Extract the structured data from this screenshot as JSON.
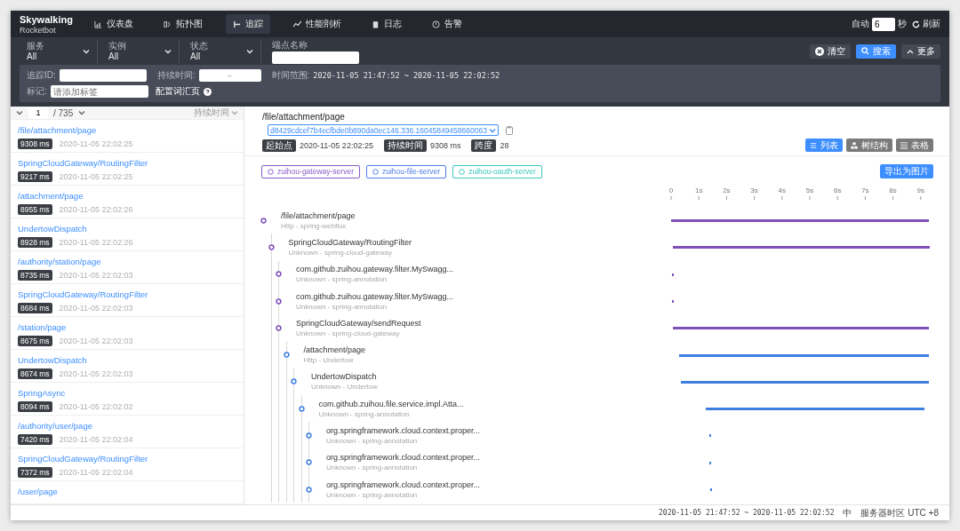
{
  "brand": {
    "name": "Skywalking",
    "sub": "Rocketbot"
  },
  "nav": [
    {
      "label": "仪表盘",
      "kind": "dashboard",
      "selected": false
    },
    {
      "label": "拓扑图",
      "kind": "topology",
      "selected": false
    },
    {
      "label": "追踪",
      "kind": "trace",
      "selected": true
    },
    {
      "label": "性能剖析",
      "kind": "profile",
      "selected": false
    },
    {
      "label": "日志",
      "kind": "log",
      "selected": false
    },
    {
      "label": "告警",
      "kind": "alarm",
      "selected": false
    }
  ],
  "auto_refresh": {
    "label": "自动",
    "value": "6",
    "unit": "秒",
    "button": "刷新"
  },
  "filters": [
    {
      "label": "服务",
      "value": "All",
      "kind": "select"
    },
    {
      "label": "实例",
      "value": "All",
      "kind": "select"
    },
    {
      "label": "状态",
      "value": "All",
      "kind": "select"
    },
    {
      "label": "端点名称",
      "kind": "input"
    }
  ],
  "actions": [
    {
      "label": "清空",
      "kind": "clear"
    },
    {
      "label": "搜索",
      "kind": "search"
    },
    {
      "label": "更多",
      "kind": "more"
    }
  ],
  "more_panel": {
    "trace_id_label": "追踪ID:",
    "duration_label": "持续时间:",
    "duration_separator": "–",
    "time_range_label": "时间范围:",
    "time_range": "2020-11-05 21:47:52 ~ 2020-11-05 22:02:52",
    "tags_label": "标记:",
    "tags_placeholder": "请添加标签",
    "vocab_link": "配置词汇页"
  },
  "list": {
    "page": "1",
    "total": "/ 735",
    "sort": "持续时间",
    "items": [
      {
        "name": "/file/attachment/page",
        "duration": "9308 ms",
        "time": "2020-11-05 22:02:25"
      },
      {
        "name": "SpringCloudGateway/RoutingFilter",
        "duration": "9217 ms",
        "time": "2020-11-05 22:02:25"
      },
      {
        "name": "/attachment/page",
        "duration": "8955 ms",
        "time": "2020-11-05 22:02:26"
      },
      {
        "name": "UndertowDispatch",
        "duration": "8928 ms",
        "time": "2020-11-05 22:02:26"
      },
      {
        "name": "/authority/station/page",
        "duration": "8735 ms",
        "time": "2020-11-05 22:02:03"
      },
      {
        "name": "SpringCloudGateway/RoutingFilter",
        "duration": "8684 ms",
        "time": "2020-11-05 22:02:03"
      },
      {
        "name": "/station/page",
        "duration": "8675 ms",
        "time": "2020-11-05 22:02:03"
      },
      {
        "name": "UndertowDispatch",
        "duration": "8674 ms",
        "time": "2020-11-05 22:02:03"
      },
      {
        "name": "SpringAsync",
        "duration": "8094 ms",
        "time": "2020-11-05 22:02:02"
      },
      {
        "name": "/authority/user/page",
        "duration": "7420 ms",
        "time": "2020-11-05 22:02:04"
      },
      {
        "name": "SpringCloudGateway/RoutingFilter",
        "duration": "7372 ms",
        "time": "2020-11-05 22:02:04"
      },
      {
        "name": "/user/page"
      }
    ]
  },
  "detail": {
    "title": "/file/attachment/page",
    "trace_id": "d8429cdcef7b4ecfbde0b890da0ec146.336.16045849458660063",
    "meta": [
      {
        "label": "起始点",
        "value": "2020-11-05 22:02:25"
      },
      {
        "label": "持续时间",
        "value": "9308 ms"
      },
      {
        "label": "跨度",
        "value": "28"
      }
    ],
    "views": [
      {
        "label": "列表",
        "kind": "list",
        "selected": true
      },
      {
        "label": "树结构",
        "kind": "tree",
        "selected": false
      },
      {
        "label": "表格",
        "kind": "table",
        "selected": false
      }
    ],
    "services": [
      {
        "name": "zuihou-gateway-server",
        "color": "#8a5cc7"
      },
      {
        "name": "zuihou-file-server",
        "color": "#4f7fe8"
      },
      {
        "name": "zuihou-oauth-server",
        "color": "#3cc8c0"
      }
    ],
    "export": "导出为图片",
    "spans": [
      {
        "name": "/file/attachment/page",
        "meta": "Http - spring-webflux",
        "color": "#7e4fb9",
        "children": [
          {
            "name": "SpringCloudGateway/RoutingFilter",
            "meta": "Unknown - spring-cloud-gateway",
            "color": "#7e4fb9",
            "children": [
              {
                "name": "com.github.zuihou.gateway.filter.MySwagg...",
                "meta": "Unknown - spring-annotation",
                "color": "#7e4fb9"
              },
              {
                "name": "com.github.zuihou.gateway.filter.MySwagg...",
                "meta": "Unknown - spring-annotation",
                "color": "#7e4fb9"
              },
              {
                "name": "SpringCloudGateway/sendRequest",
                "meta": "Unknown - spring-cloud-gateway",
                "color": "#7e4fb9",
                "children": [
                  {
                    "name": "/attachment/page",
                    "meta": "Http - Undertow",
                    "color": "#3d7fe0",
                    "children": [
                      {
                        "name": "UndertowDispatch",
                        "meta": "Unknown - Undertow",
                        "color": "#3d7fe0",
                        "children": [
                          {
                            "name": "com.github.zuihou.file.service.impl.Atta...",
                            "meta": "Unknown - spring-annotation",
                            "color": "#3d7fe0",
                            "children": [
                              {
                                "name": "org.springframework.cloud.context.proper...",
                                "meta": "Unknown - spring-annotation",
                                "color": "#3d7fe0"
                              },
                              {
                                "name": "org.springframework.cloud.context.proper...",
                                "meta": "Unknown - spring-annotation",
                                "color": "#3d7fe0"
                              },
                              {
                                "name": "org.springframework.cloud.context.proper...",
                                "meta": "Unknown - spring-annotation",
                                "color": "#3d7fe0"
                              }
                            ]
                          }
                        ]
                      }
                    ]
                  }
                ]
              }
            ]
          }
        ]
      }
    ],
    "timeline_ticks": [
      "0",
      "1s",
      "2s",
      "3s",
      "4s",
      "5s",
      "6s",
      "7s",
      "8s",
      "9s"
    ]
  },
  "footer": {
    "time_range": "2020-11-05 21:47:52 ~ 2020-11-05 22:02:52",
    "lang": "中",
    "timezone": "服务器时区 UTC +8"
  }
}
